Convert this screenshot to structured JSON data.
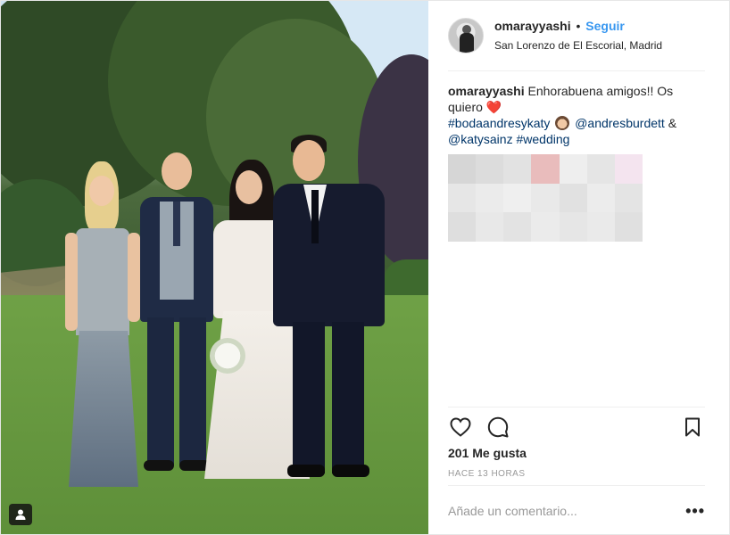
{
  "header": {
    "username": "omarayyashi",
    "separator": "•",
    "follow_label": "Seguir",
    "location": "San Lorenzo de El Escorial, Madrid",
    "avatar_icon": "profile-avatar"
  },
  "caption": {
    "username": "omarayyashi",
    "text_1": " Enhorabuena amigos!! Os quiero ",
    "heart": "❤️",
    "hashtag_1": "#bodaandresykaty",
    "mention_1": "@andresburdett",
    "amp": " & ",
    "mention_2": "@katysainz",
    "hashtag_2": "#wedding"
  },
  "actions": {
    "like_icon": "heart-icon",
    "comment_icon": "comment-icon",
    "save_icon": "bookmark-icon"
  },
  "likes": "201 Me gusta",
  "timestamp": "HACE 13 HORAS",
  "comment": {
    "placeholder": "Añade un comentario...",
    "more_label": "•••"
  },
  "photo": {
    "tag_icon": "user-tag-icon"
  },
  "colors": {
    "accent_blue": "#3897f0",
    "link_blue": "#003569",
    "text": "#262626",
    "muted": "#999999"
  }
}
